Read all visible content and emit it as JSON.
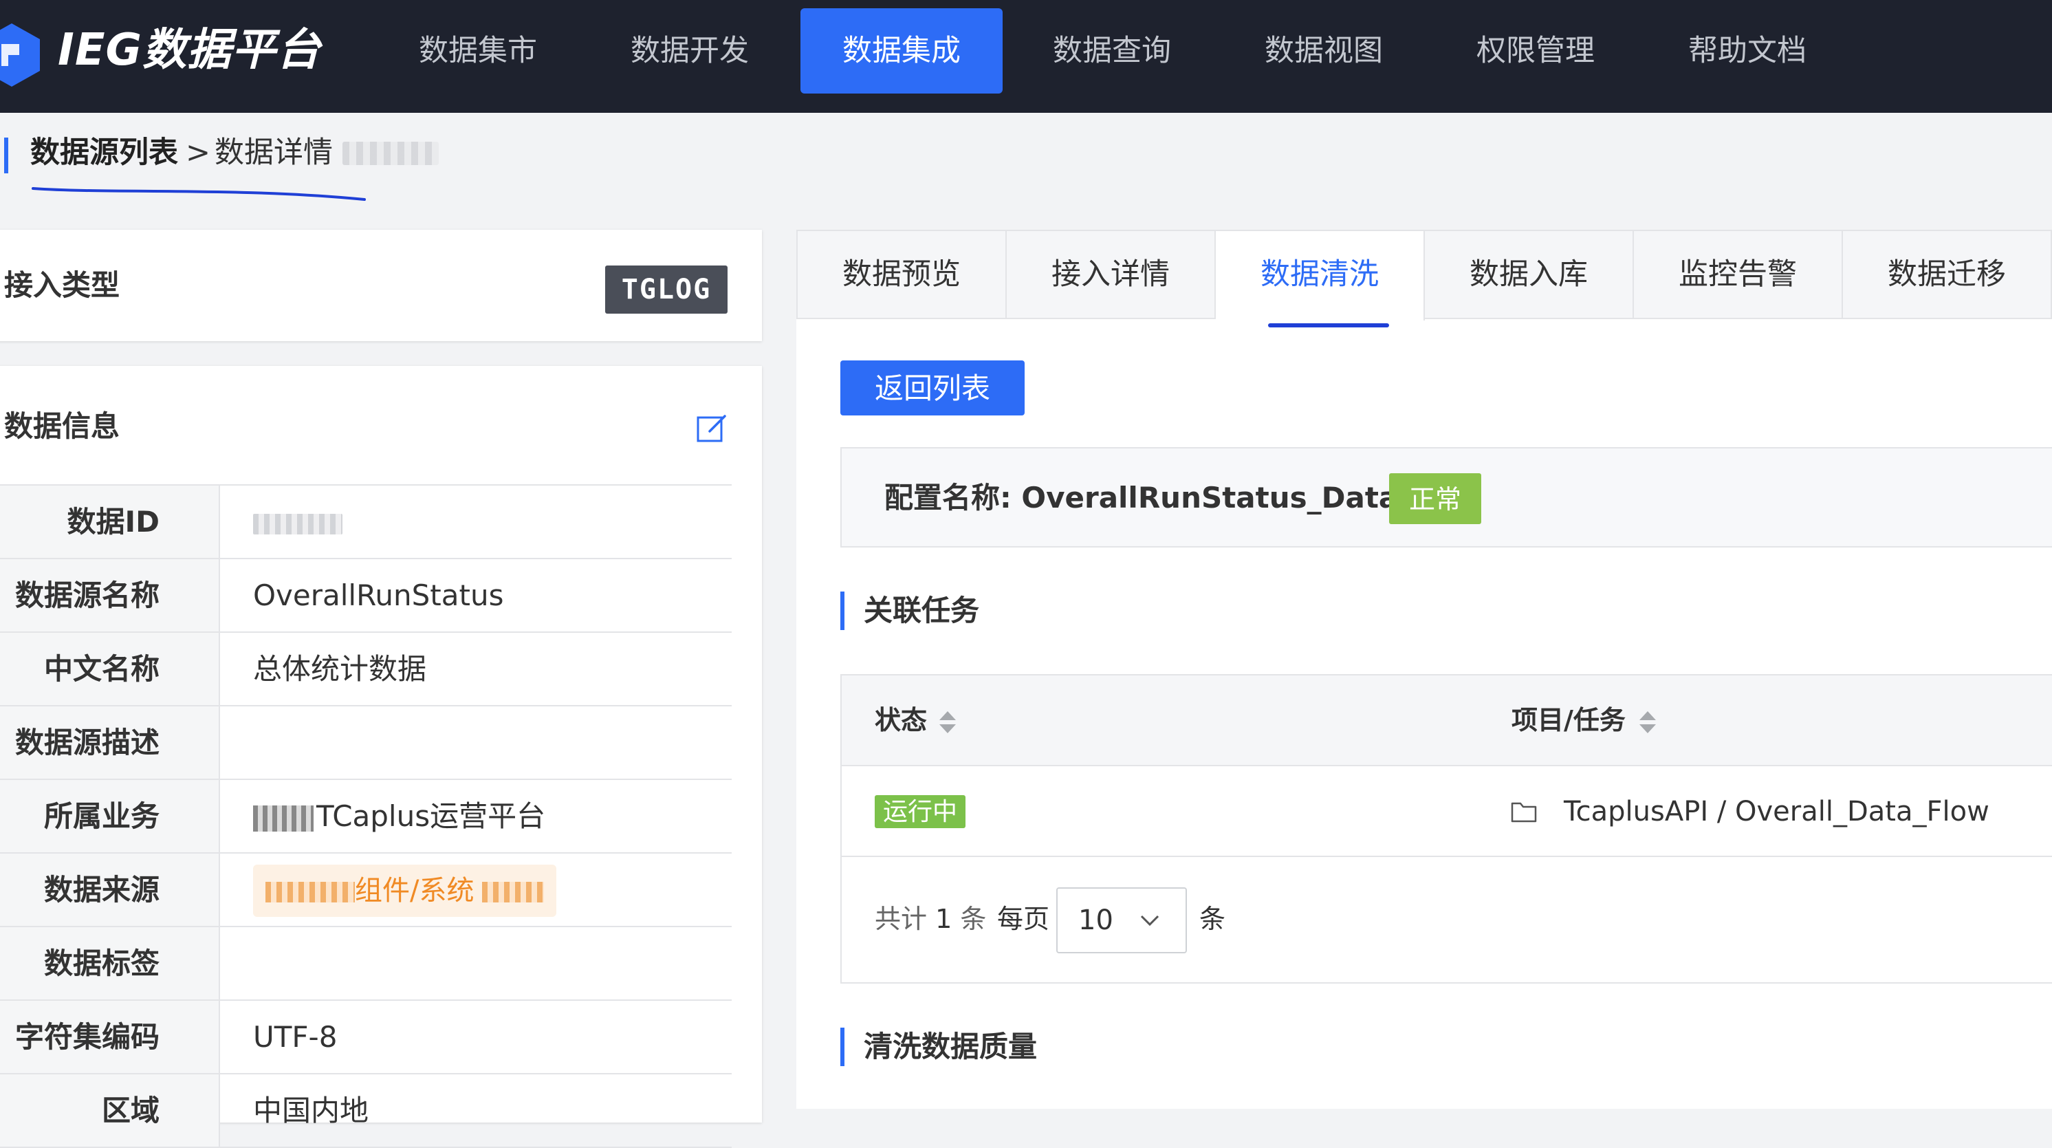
{
  "app": {
    "logo_text": "IEG数据平台",
    "accent_color": "#2d6cf6",
    "nav": [
      {
        "label": "数据集市"
      },
      {
        "label": "数据开发"
      },
      {
        "label": "数据集成",
        "active": true
      },
      {
        "label": "数据查询"
      },
      {
        "label": "数据视图"
      },
      {
        "label": "权限管理"
      },
      {
        "label": "帮助文档"
      }
    ]
  },
  "breadcrumb": {
    "root": "数据源列表",
    "separator": ">",
    "current": "数据详情"
  },
  "left": {
    "type_label": "接入类型",
    "type_value": "TGLOG",
    "info_title": "数据信息",
    "rows": [
      {
        "key": "数据ID",
        "value": ""
      },
      {
        "key": "数据源名称",
        "value": "OverallRunStatus"
      },
      {
        "key": "中文名称",
        "value": "总体统计数据"
      },
      {
        "key": "数据源描述",
        "value": ""
      },
      {
        "key": "所属业务",
        "value": "TCaplus运营平台"
      },
      {
        "key": "数据来源",
        "value": "组件/系统"
      },
      {
        "key": "数据标签",
        "value": ""
      },
      {
        "key": "字符集编码",
        "value": "UTF-8"
      },
      {
        "key": "区域",
        "value": "中国内地"
      }
    ]
  },
  "tabs": [
    {
      "label": "数据预览"
    },
    {
      "label": "接入详情"
    },
    {
      "label": "数据清洗",
      "active": true
    },
    {
      "label": "数据入库"
    },
    {
      "label": "监控告警"
    },
    {
      "label": "数据迁移"
    }
  ],
  "clean": {
    "back_button": "返回列表",
    "config_label": "配置名称: OverallRunStatus_Data",
    "config_status": "正常",
    "related_title": "关联任务",
    "columns": {
      "status": "状态",
      "project": "项目/任务"
    },
    "task": {
      "status": "运行中",
      "path": "TcaplusAPI  /  Overall_Data_Flow"
    },
    "pager": {
      "total_prefix": "共计",
      "total": "1",
      "total_suffix": "条",
      "per_page_label": "每页",
      "per_page": "10",
      "per_page_suffix": "条"
    },
    "quality_title": "清洗数据质量"
  }
}
